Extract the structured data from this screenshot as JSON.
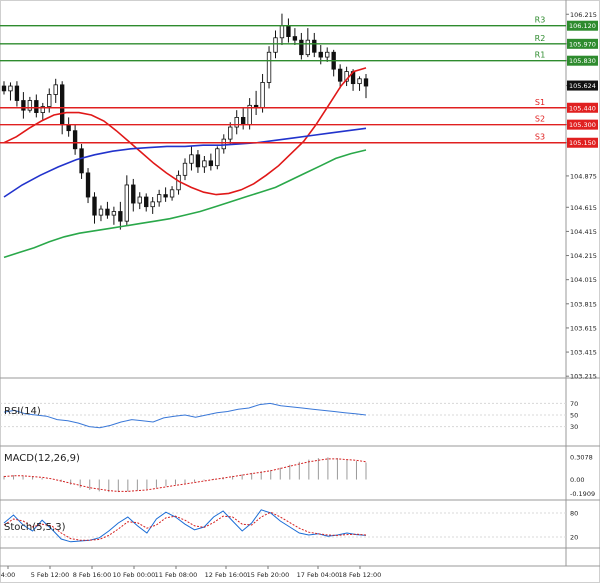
{
  "chart_data": [
    {
      "type": "candlestick",
      "panel": "price",
      "ylim": [
        103.2,
        106.3
      ],
      "y_ticks": [
        "106.215",
        "105.970",
        "105.830",
        "105.624",
        "105.440",
        "105.300",
        "105.150",
        "104.875",
        "104.615",
        "104.415",
        "104.215",
        "104.015",
        "103.815",
        "103.615",
        "103.415",
        "103.215"
      ],
      "x_ticks": [
        "4:00",
        "5 Feb 12:00",
        "8 Feb 16:00",
        "10 Feb 00:00",
        "11 Feb 08:00",
        "12 Feb 16:00",
        "15 Feb 20:00",
        "17 Feb 04:00",
        "18 Feb 12:00"
      ],
      "current_price": "105.624",
      "levels": [
        {
          "name": "R3",
          "value": 106.12,
          "tag": "106.120",
          "color": "#2e8b2e"
        },
        {
          "name": "R2",
          "value": 105.97,
          "tag": "105.970",
          "color": "#2e8b2e"
        },
        {
          "name": "R1",
          "value": 105.83,
          "tag": "105.830",
          "color": "#2e8b2e"
        },
        {
          "name": "S1",
          "value": 105.44,
          "tag": "105.440",
          "color": "#e02020"
        },
        {
          "name": "S2",
          "value": 105.3,
          "tag": "105.300",
          "color": "#e02020"
        },
        {
          "name": "S3",
          "value": 105.15,
          "tag": "105.150",
          "color": "#e02020"
        }
      ],
      "candles": [
        [
          105.62,
          105.66,
          105.55,
          105.58
        ],
        [
          105.58,
          105.65,
          105.5,
          105.62
        ],
        [
          105.62,
          105.66,
          105.45,
          105.5
        ],
        [
          105.5,
          105.57,
          105.35,
          105.42
        ],
        [
          105.42,
          105.53,
          105.4,
          105.5
        ],
        [
          105.5,
          105.55,
          105.36,
          105.4
        ],
        [
          105.4,
          105.48,
          105.33,
          105.45
        ],
        [
          105.45,
          105.6,
          105.4,
          105.55
        ],
        [
          105.55,
          105.68,
          105.48,
          105.63
        ],
        [
          105.63,
          105.66,
          105.22,
          105.3
        ],
        [
          105.3,
          105.36,
          105.2,
          105.25
        ],
        [
          105.25,
          105.3,
          105.05,
          105.1
        ],
        [
          105.1,
          105.14,
          104.85,
          104.9
        ],
        [
          104.9,
          104.94,
          104.65,
          104.7
        ],
        [
          104.7,
          104.74,
          104.48,
          104.55
        ],
        [
          104.55,
          104.63,
          104.5,
          104.6
        ],
        [
          104.6,
          104.66,
          104.52,
          104.55
        ],
        [
          104.55,
          104.62,
          104.47,
          104.58
        ],
        [
          104.58,
          104.66,
          104.43,
          104.5
        ],
        [
          104.5,
          104.88,
          104.46,
          104.8
        ],
        [
          104.8,
          104.85,
          104.58,
          104.65
        ],
        [
          104.65,
          104.74,
          104.6,
          104.7
        ],
        [
          104.7,
          104.73,
          104.58,
          104.62
        ],
        [
          104.62,
          104.7,
          104.56,
          104.66
        ],
        [
          104.66,
          104.76,
          104.62,
          104.72
        ],
        [
          104.72,
          104.78,
          104.66,
          104.7
        ],
        [
          104.7,
          104.79,
          104.67,
          104.76
        ],
        [
          104.76,
          104.92,
          104.72,
          104.88
        ],
        [
          104.88,
          105.02,
          104.84,
          104.98
        ],
        [
          104.98,
          105.12,
          104.92,
          105.05
        ],
        [
          105.05,
          105.09,
          104.9,
          104.95
        ],
        [
          104.95,
          105.04,
          104.9,
          105.0
        ],
        [
          105.0,
          105.06,
          104.92,
          104.96
        ],
        [
          104.96,
          105.12,
          104.93,
          105.1
        ],
        [
          105.1,
          105.22,
          105.06,
          105.18
        ],
        [
          105.18,
          105.32,
          105.14,
          105.28
        ],
        [
          105.28,
          105.42,
          105.22,
          105.36
        ],
        [
          105.36,
          105.44,
          105.26,
          105.3
        ],
        [
          105.3,
          105.52,
          105.26,
          105.46
        ],
        [
          105.46,
          105.58,
          105.38,
          105.44
        ],
        [
          105.44,
          105.72,
          105.4,
          105.65
        ],
        [
          105.65,
          105.95,
          105.6,
          105.9
        ],
        [
          105.9,
          106.08,
          105.85,
          106.02
        ],
        [
          106.02,
          106.22,
          105.96,
          106.12
        ],
        [
          106.12,
          106.18,
          105.98,
          106.03
        ],
        [
          106.03,
          106.1,
          105.96,
          106.0
        ],
        [
          106.0,
          106.06,
          105.84,
          105.88
        ],
        [
          105.88,
          106.1,
          105.86,
          106.0
        ],
        [
          106.0,
          106.06,
          105.86,
          105.9
        ],
        [
          105.9,
          105.96,
          105.8,
          105.86
        ],
        [
          105.86,
          105.94,
          105.82,
          105.9
        ],
        [
          105.9,
          105.92,
          105.7,
          105.76
        ],
        [
          105.76,
          105.8,
          105.6,
          105.66
        ],
        [
          105.66,
          105.78,
          105.62,
          105.74
        ],
        [
          105.74,
          105.76,
          105.58,
          105.64
        ],
        [
          105.64,
          105.7,
          105.58,
          105.68
        ],
        [
          105.68,
          105.72,
          105.52,
          105.62
        ]
      ],
      "series": [
        {
          "name": "",
          "color": "#e01818",
          "values": [
            105.15,
            105.2,
            105.27,
            105.33,
            105.38,
            105.4,
            105.4,
            105.38,
            105.33,
            105.25,
            105.16,
            105.07,
            104.98,
            104.9,
            104.83,
            104.78,
            104.74,
            104.72,
            104.73,
            104.76,
            104.81,
            104.88,
            104.96,
            105.06,
            105.16,
            105.3,
            105.46,
            105.62,
            105.74,
            105.77
          ]
        },
        {
          "name": "",
          "color": "#2233cc",
          "values": [
            104.7,
            104.8,
            104.88,
            104.95,
            105.01,
            105.05,
            105.08,
            105.1,
            105.11,
            105.12,
            105.12,
            105.13,
            105.13,
            105.14,
            105.15,
            105.17,
            105.19,
            105.21,
            105.23,
            105.25,
            105.27
          ]
        },
        {
          "name": "",
          "color": "#2aa84a",
          "values": [
            104.2,
            104.24,
            104.28,
            104.33,
            104.37,
            104.4,
            104.42,
            104.44,
            104.46,
            104.48,
            104.5,
            104.52,
            104.55,
            104.58,
            104.62,
            104.66,
            104.7,
            104.74,
            104.78,
            104.84,
            104.9,
            104.96,
            105.02,
            105.06,
            105.09
          ]
        }
      ]
    },
    {
      "type": "line",
      "panel": "rsi",
      "title": "RSI(14)",
      "ylim": [
        0,
        100
      ],
      "y_ticks": [
        "70",
        "50",
        "30"
      ],
      "series": [
        {
          "name": "",
          "color": "#3a78d8",
          "values": [
            55,
            58,
            52,
            50,
            48,
            42,
            40,
            36,
            30,
            28,
            32,
            38,
            42,
            40,
            38,
            45,
            48,
            50,
            46,
            50,
            54,
            56,
            60,
            62,
            68,
            70,
            66,
            64,
            62,
            60,
            58,
            56,
            54,
            52,
            50
          ]
        }
      ]
    },
    {
      "type": "bar",
      "panel": "macd",
      "title": "MACD(12,26,9)",
      "ylim": [
        -0.25,
        0.4
      ],
      "y_ticks": [
        "0.3078",
        "0.00",
        "-0.1909"
      ],
      "values": [
        0.05,
        0.06,
        0.05,
        0.04,
        0.02,
        0.0,
        -0.03,
        -0.07,
        -0.11,
        -0.14,
        -0.16,
        -0.17,
        -0.17,
        -0.16,
        -0.15,
        -0.13,
        -0.11,
        -0.09,
        -0.07,
        -0.05,
        -0.03,
        -0.01,
        0.01,
        0.03,
        0.05,
        0.07,
        0.09,
        0.11,
        0.13,
        0.16,
        0.2,
        0.24,
        0.27,
        0.29,
        0.3,
        0.29,
        0.27,
        0.25,
        0.23
      ],
      "series": [
        {
          "name": "",
          "color": "#d42020",
          "values": [
            0.04,
            0.05,
            0.05,
            0.04,
            0.03,
            0.01,
            -0.02,
            -0.05,
            -0.08,
            -0.11,
            -0.13,
            -0.15,
            -0.16,
            -0.16,
            -0.15,
            -0.14,
            -0.12,
            -0.1,
            -0.08,
            -0.06,
            -0.04,
            -0.02,
            0.0,
            0.02,
            0.04,
            0.06,
            0.08,
            0.1,
            0.12,
            0.15,
            0.18,
            0.21,
            0.24,
            0.26,
            0.28,
            0.28,
            0.27,
            0.26,
            0.24
          ]
        }
      ]
    },
    {
      "type": "line",
      "panel": "stoch",
      "title": "Stoch(5,5,3)",
      "ylim": [
        0,
        100
      ],
      "y_ticks": [
        "80",
        "20"
      ],
      "series": [
        {
          "name": "",
          "color": "#1a6cd6",
          "values": [
            55,
            75,
            50,
            35,
            62,
            40,
            15,
            8,
            10,
            12,
            18,
            35,
            55,
            70,
            48,
            30,
            65,
            82,
            70,
            52,
            38,
            45,
            70,
            85,
            60,
            35,
            55,
            88,
            80,
            60,
            45,
            30,
            25,
            28,
            22,
            25,
            30,
            26,
            24
          ]
        },
        {
          "name": "",
          "color": "#d42020",
          "values": [
            50,
            65,
            60,
            45,
            52,
            48,
            30,
            16,
            12,
            12,
            14,
            24,
            40,
            58,
            56,
            42,
            50,
            68,
            72,
            62,
            48,
            44,
            56,
            72,
            70,
            52,
            50,
            70,
            82,
            70,
            56,
            42,
            32,
            28,
            25,
            24,
            26,
            27,
            25
          ]
        }
      ]
    }
  ]
}
